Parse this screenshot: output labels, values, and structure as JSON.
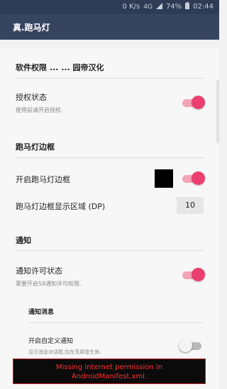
{
  "status_bar": {
    "net_speed": "0 K/s",
    "network_type": "4G",
    "battery": "74%",
    "time": "02:44",
    "icons": [
      "network-type-icon",
      "signal-icon",
      "battery-icon"
    ]
  },
  "app_bar": {
    "title": "真.跑马灯"
  },
  "credit": {
    "title": "软件权限 ... ... 园帝汉化"
  },
  "auth": {
    "label": "授权状态",
    "summary": "使用前请开启授权.",
    "enabled": true
  },
  "border_section": {
    "title": "跑马灯边框"
  },
  "enable_border": {
    "label": "开启跑马灯边框",
    "enabled": true,
    "color": "#000000"
  },
  "border_area": {
    "label": "跑马灯边框显示区域 (DP)",
    "value": "10"
  },
  "notify_section": {
    "title": "通知"
  },
  "notify_permission": {
    "label": "通知许可状态",
    "summary": "需要开启S8通知许可权限.",
    "enabled": true
  },
  "notify_sub": {
    "title": "通知消息"
  },
  "custom_notify": {
    "label": "开启自定义通知",
    "summary": "显示消息对话框,仅在亮屏是生效.",
    "enabled": false
  },
  "toast": {
    "line1": "Missing internet permission in",
    "line2": "AndroidManifest.xml."
  },
  "colors": {
    "accent": "#ea3f6f",
    "app_bar": "#36445f",
    "status_bar": "#2e3b55",
    "toast_text": "#ff3030"
  }
}
